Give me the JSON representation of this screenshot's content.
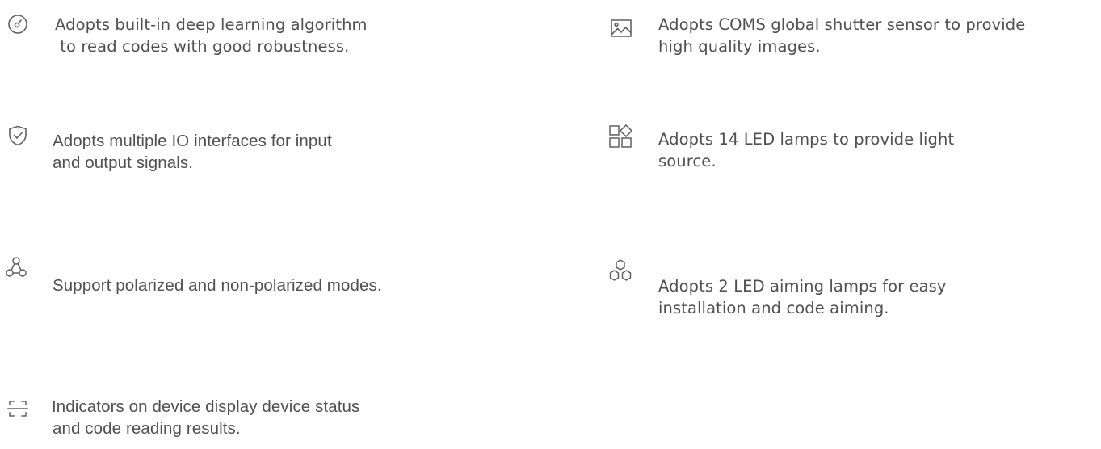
{
  "features": {
    "left": [
      {
        "icon": "gauge-icon",
        "lines": [
          "Adopts built-in deep learning algorithm",
          " to read codes with good robustness."
        ]
      },
      {
        "icon": "shield-check-icon",
        "lines": [
          "Adopts multiple IO interfaces for input",
          "and output signals."
        ]
      },
      {
        "icon": "nodes-icon",
        "lines": [
          "Support polarized and non-polarized modes."
        ]
      },
      {
        "icon": "scan-frame-icon",
        "lines": [
          "Indicators on device display device status",
          "and code reading results."
        ]
      }
    ],
    "right": [
      {
        "icon": "image-icon",
        "lines": [
          "Adopts COMS global shutter sensor to provide",
          "high quality images."
        ]
      },
      {
        "icon": "apps-grid-icon",
        "lines": [
          "Adopts 14 LED lamps to provide light",
          "source."
        ]
      },
      {
        "icon": "hexagons-icon",
        "lines": [
          "Adopts 2 LED aiming lamps for easy",
          "installation and code aiming."
        ]
      }
    ]
  },
  "colors": {
    "text": "#505050",
    "icon": "#606060"
  }
}
